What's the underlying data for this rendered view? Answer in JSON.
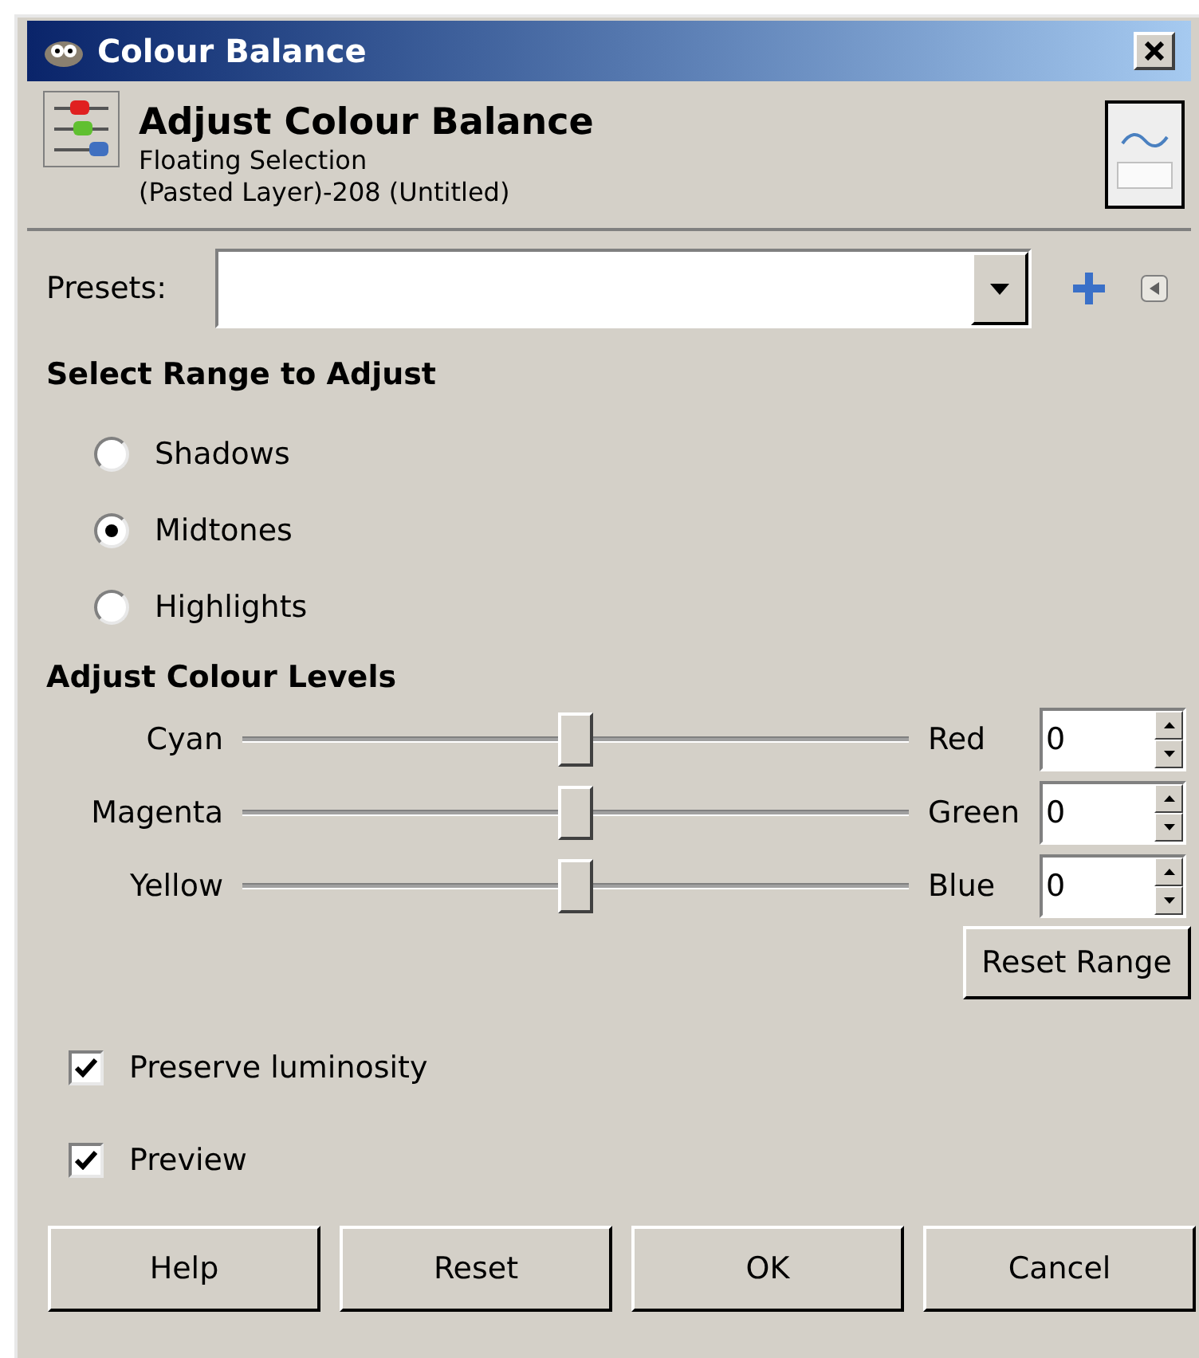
{
  "window": {
    "title": "Colour Balance"
  },
  "header": {
    "title": "Adjust Colour Balance",
    "subtitle": "Floating Selection",
    "detail": "(Pasted Layer)-208 (Untitled)"
  },
  "presets": {
    "label": "Presets:"
  },
  "range_section": {
    "title": "Select Range to Adjust",
    "options": [
      {
        "label": "Shadows",
        "selected": false
      },
      {
        "label": "Midtones",
        "selected": true
      },
      {
        "label": "Highlights",
        "selected": false
      }
    ]
  },
  "levels_section": {
    "title": "Adjust Colour Levels",
    "sliders": [
      {
        "left": "Cyan",
        "right": "Red",
        "level": 0.5,
        "value": "0"
      },
      {
        "left": "Magenta",
        "right": "Green",
        "level": 0.5,
        "value": "0"
      },
      {
        "left": "Yellow",
        "right": "Blue",
        "level": 0.5,
        "value": "0"
      }
    ],
    "reset_button": "Reset Range"
  },
  "checkboxes": [
    {
      "label": "Preserve luminosity",
      "checked": true
    },
    {
      "label": "Preview",
      "checked": true
    }
  ],
  "buttons": [
    "Help",
    "Reset",
    "OK",
    "Cancel"
  ]
}
